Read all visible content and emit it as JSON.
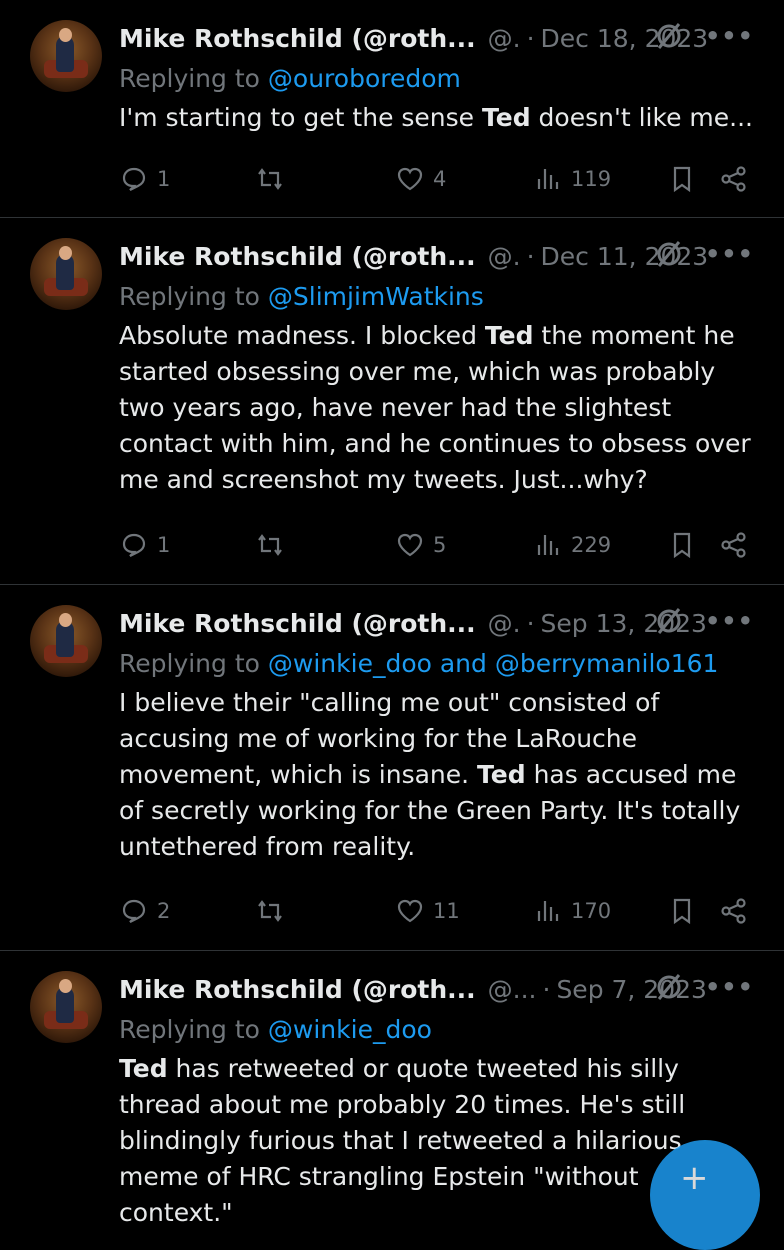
{
  "tweets": [
    {
      "name": "Mike Rothschild (@roth...",
      "handle": "@.",
      "date": "Dec 18, 2023",
      "replying_prefix": "Replying to",
      "replying_to": "@ouroboredom",
      "body_parts": [
        "I'm starting to get the sense ",
        "Ted",
        " doesn't like me..."
      ],
      "replies": "1",
      "likes": "4",
      "views": "119"
    },
    {
      "name": "Mike Rothschild (@roth...",
      "handle": "@.",
      "date": "Dec 11, 2023",
      "replying_prefix": "Replying to",
      "replying_to": "@SlimjimWatkins",
      "body_parts": [
        "Absolute madness. I blocked ",
        "Ted",
        " the moment he started obsessing over me, which was probably two years ago, have never had the slightest contact with him, and he continues to obsess over me and screenshot my tweets. Just...why?"
      ],
      "replies": "1",
      "likes": "5",
      "views": "229"
    },
    {
      "name": "Mike Rothschild (@roth...",
      "handle": "@.",
      "date": "Sep 13, 2023",
      "replying_prefix": "Replying to",
      "replying_to": "@winkie_doo and @berrymanilo161",
      "body_parts": [
        "I believe their \"calling me out\" consisted of accusing me of working for the LaRouche movement, which is insane. ",
        "Ted",
        " has accused me of secretly working for the Green Party. It's totally untethered from reality."
      ],
      "replies": "2",
      "likes": "11",
      "views": "170"
    },
    {
      "name": "Mike Rothschild (@roth...",
      "handle": "@...",
      "date": "Sep 7, 2023",
      "replying_prefix": "Replying to",
      "replying_to": "@winkie_doo",
      "body_parts": [
        "",
        "Ted",
        " has retweeted or quote tweeted his silly thread about me probably 20 times. He's still blindingly furious that I retweeted a hilarious meme of HRC strangling Epstein \"without context.\""
      ]
    }
  ],
  "more_label": "•••",
  "fab_label": "+",
  "colors": {
    "accent": "#1d9bf0",
    "muted": "#71767b",
    "text": "#e7e9ea",
    "divider": "#2f3336"
  }
}
